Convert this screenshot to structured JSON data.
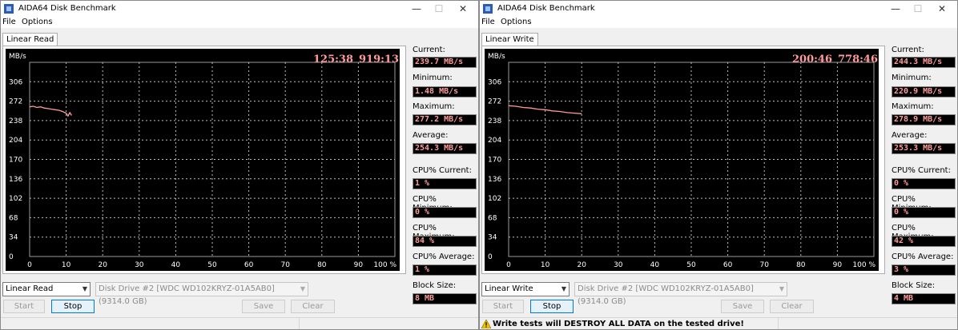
{
  "windows": [
    {
      "title": "AIDA64 Disk Benchmark",
      "menu": [
        "File",
        "Options"
      ],
      "tab_label": "Linear Read",
      "time_left": "125:38",
      "time_right": "919:13",
      "stats": [
        {
          "label": "Current:",
          "value": "239.7 MB/s"
        },
        {
          "label": "Minimum:",
          "value": "1.48 MB/s"
        },
        {
          "label": "Maximum:",
          "value": "277.2 MB/s"
        },
        {
          "label": "Average:",
          "value": "254.3 MB/s"
        },
        {
          "label": "CPU% Current:",
          "value": "1 %"
        },
        {
          "label": "CPU% Minimum:",
          "value": "0 %"
        },
        {
          "label": "CPU% Maximum:",
          "value": "84 %"
        },
        {
          "label": "CPU% Average:",
          "value": "1 %"
        },
        {
          "label": "Block Size:",
          "value": "8 MB"
        }
      ],
      "test_select": "Linear Read",
      "drive_select": "Disk Drive #2  [WDC WD102KRYZ-01A5AB0]  (9314.0 GB)",
      "buttons": {
        "start": "Start",
        "stop": "Stop",
        "save": "Save",
        "clear": "Clear"
      },
      "warning": "",
      "chart_data": {
        "type": "line",
        "ylabel": "MB/s",
        "y_ticks": [
          "306",
          "272",
          "238",
          "204",
          "170",
          "136",
          "102",
          "68",
          "34",
          "0"
        ],
        "x_ticks": [
          "0",
          "10",
          "20",
          "30",
          "40",
          "50",
          "60",
          "70",
          "80",
          "90",
          "100 %"
        ],
        "xlim": [
          0,
          100
        ],
        "ylim": [
          0,
          340
        ],
        "grid": true,
        "series_color": "#ff9b9b",
        "x": [
          0,
          1,
          2,
          3,
          4,
          5,
          6,
          7,
          8,
          9,
          10,
          10.5,
          11,
          11.5
        ],
        "y": [
          262,
          263,
          261,
          262,
          260,
          259,
          258,
          257,
          256,
          254,
          251,
          246,
          252,
          247
        ]
      }
    },
    {
      "title": "AIDA64 Disk Benchmark",
      "menu": [
        "File",
        "Options"
      ],
      "tab_label": "Linear Write",
      "time_left": "200:46",
      "time_right": "778:46",
      "stats": [
        {
          "label": "Current:",
          "value": "244.3 MB/s"
        },
        {
          "label": "Minimum:",
          "value": "220.9 MB/s"
        },
        {
          "label": "Maximum:",
          "value": "278.9 MB/s"
        },
        {
          "label": "Average:",
          "value": "253.3 MB/s"
        },
        {
          "label": "CPU% Current:",
          "value": "0 %"
        },
        {
          "label": "CPU% Minimum:",
          "value": "0 %"
        },
        {
          "label": "CPU% Maximum:",
          "value": "42 %"
        },
        {
          "label": "CPU% Average:",
          "value": "3 %"
        },
        {
          "label": "Block Size:",
          "value": "4 MB"
        }
      ],
      "test_select": "Linear Write",
      "drive_select": "Disk Drive #2  [WDC WD102KRYZ-01A5AB0]  (9314.0 GB)",
      "buttons": {
        "start": "Start",
        "stop": "Stop",
        "save": "Save",
        "clear": "Clear"
      },
      "warning": "Write tests will DESTROY ALL DATA on the tested drive!",
      "chart_data": {
        "type": "line",
        "ylabel": "MB/s",
        "y_ticks": [
          "306",
          "272",
          "238",
          "204",
          "170",
          "136",
          "102",
          "68",
          "34",
          "0"
        ],
        "x_ticks": [
          "0",
          "10",
          "20",
          "30",
          "40",
          "50",
          "60",
          "70",
          "80",
          "90",
          "100 %"
        ],
        "xlim": [
          0,
          100
        ],
        "ylim": [
          0,
          340
        ],
        "grid": true,
        "series_color": "#ff9b9b",
        "x": [
          0,
          2,
          4,
          6,
          8,
          10,
          12,
          14,
          16,
          18,
          20
        ],
        "y": [
          264,
          263,
          261,
          260,
          258,
          257,
          255,
          254,
          252,
          251,
          250
        ]
      }
    }
  ]
}
